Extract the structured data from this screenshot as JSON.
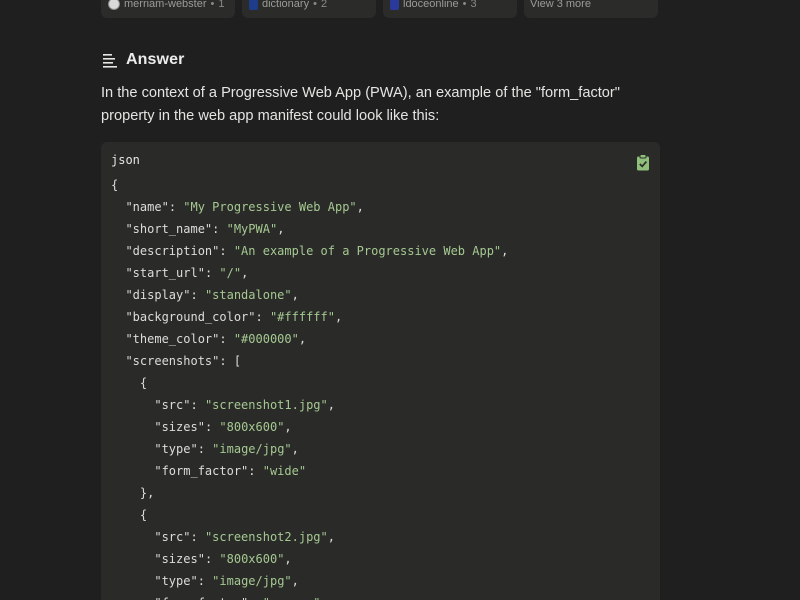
{
  "sources": [
    {
      "name": "merriam-webster",
      "count": "1",
      "icon": "merriam-webster-favicon"
    },
    {
      "name": "dictionary",
      "count": "2",
      "icon": "dictionary-favicon"
    },
    {
      "name": "ldoceonline",
      "count": "3",
      "icon": "ldoceonline-favicon"
    }
  ],
  "view_more": "View 3 more",
  "answer": {
    "title": "Answer",
    "icon": "answer-lines-icon",
    "intro": "In the context of a Progressive Web App (PWA), an example of the \"form_factor\" property in the web app manifest could look like this:"
  },
  "code": {
    "language": "json",
    "copy_icon": "clipboard-check-icon",
    "colors": {
      "string": "#a5c991",
      "copy_icon": "#8fbf7a",
      "background": "#2a2a29"
    },
    "lines": [
      [
        {
          "t": "p",
          "v": "{"
        }
      ],
      [
        {
          "t": "p",
          "v": "  "
        },
        {
          "t": "k",
          "v": "\"name\""
        },
        {
          "t": "p",
          "v": ": "
        },
        {
          "t": "s",
          "v": "\"My Progressive Web App\""
        },
        {
          "t": "p",
          "v": ","
        }
      ],
      [
        {
          "t": "p",
          "v": "  "
        },
        {
          "t": "k",
          "v": "\"short_name\""
        },
        {
          "t": "p",
          "v": ": "
        },
        {
          "t": "s",
          "v": "\"MyPWA\""
        },
        {
          "t": "p",
          "v": ","
        }
      ],
      [
        {
          "t": "p",
          "v": "  "
        },
        {
          "t": "k",
          "v": "\"description\""
        },
        {
          "t": "p",
          "v": ": "
        },
        {
          "t": "s",
          "v": "\"An example of a Progressive Web App\""
        },
        {
          "t": "p",
          "v": ","
        }
      ],
      [
        {
          "t": "p",
          "v": "  "
        },
        {
          "t": "k",
          "v": "\"start_url\""
        },
        {
          "t": "p",
          "v": ": "
        },
        {
          "t": "s",
          "v": "\"/\""
        },
        {
          "t": "p",
          "v": ","
        }
      ],
      [
        {
          "t": "p",
          "v": "  "
        },
        {
          "t": "k",
          "v": "\"display\""
        },
        {
          "t": "p",
          "v": ": "
        },
        {
          "t": "s",
          "v": "\"standalone\""
        },
        {
          "t": "p",
          "v": ","
        }
      ],
      [
        {
          "t": "p",
          "v": "  "
        },
        {
          "t": "k",
          "v": "\"background_color\""
        },
        {
          "t": "p",
          "v": ": "
        },
        {
          "t": "s",
          "v": "\"#ffffff\""
        },
        {
          "t": "p",
          "v": ","
        }
      ],
      [
        {
          "t": "p",
          "v": "  "
        },
        {
          "t": "k",
          "v": "\"theme_color\""
        },
        {
          "t": "p",
          "v": ": "
        },
        {
          "t": "s",
          "v": "\"#000000\""
        },
        {
          "t": "p",
          "v": ","
        }
      ],
      [
        {
          "t": "p",
          "v": "  "
        },
        {
          "t": "k",
          "v": "\"screenshots\""
        },
        {
          "t": "p",
          "v": ": ["
        }
      ],
      [
        {
          "t": "p",
          "v": "    {"
        }
      ],
      [
        {
          "t": "p",
          "v": "      "
        },
        {
          "t": "k",
          "v": "\"src\""
        },
        {
          "t": "p",
          "v": ": "
        },
        {
          "t": "s",
          "v": "\"screenshot1.jpg\""
        },
        {
          "t": "p",
          "v": ","
        }
      ],
      [
        {
          "t": "p",
          "v": "      "
        },
        {
          "t": "k",
          "v": "\"sizes\""
        },
        {
          "t": "p",
          "v": ": "
        },
        {
          "t": "s",
          "v": "\"800x600\""
        },
        {
          "t": "p",
          "v": ","
        }
      ],
      [
        {
          "t": "p",
          "v": "      "
        },
        {
          "t": "k",
          "v": "\"type\""
        },
        {
          "t": "p",
          "v": ": "
        },
        {
          "t": "s",
          "v": "\"image/jpg\""
        },
        {
          "t": "p",
          "v": ","
        }
      ],
      [
        {
          "t": "p",
          "v": "      "
        },
        {
          "t": "k",
          "v": "\"form_factor\""
        },
        {
          "t": "p",
          "v": ": "
        },
        {
          "t": "s",
          "v": "\"wide\""
        }
      ],
      [
        {
          "t": "p",
          "v": "    },"
        }
      ],
      [
        {
          "t": "p",
          "v": "    {"
        }
      ],
      [
        {
          "t": "p",
          "v": "      "
        },
        {
          "t": "k",
          "v": "\"src\""
        },
        {
          "t": "p",
          "v": ": "
        },
        {
          "t": "s",
          "v": "\"screenshot2.jpg\""
        },
        {
          "t": "p",
          "v": ","
        }
      ],
      [
        {
          "t": "p",
          "v": "      "
        },
        {
          "t": "k",
          "v": "\"sizes\""
        },
        {
          "t": "p",
          "v": ": "
        },
        {
          "t": "s",
          "v": "\"800x600\""
        },
        {
          "t": "p",
          "v": ","
        }
      ],
      [
        {
          "t": "p",
          "v": "      "
        },
        {
          "t": "k",
          "v": "\"type\""
        },
        {
          "t": "p",
          "v": ": "
        },
        {
          "t": "s",
          "v": "\"image/jpg\""
        },
        {
          "t": "p",
          "v": ","
        }
      ],
      [
        {
          "t": "p",
          "v": "      "
        },
        {
          "t": "k",
          "v": "\"form_factor\""
        },
        {
          "t": "p",
          "v": ": "
        },
        {
          "t": "s",
          "v": "\"narrow\""
        }
      ]
    ]
  }
}
